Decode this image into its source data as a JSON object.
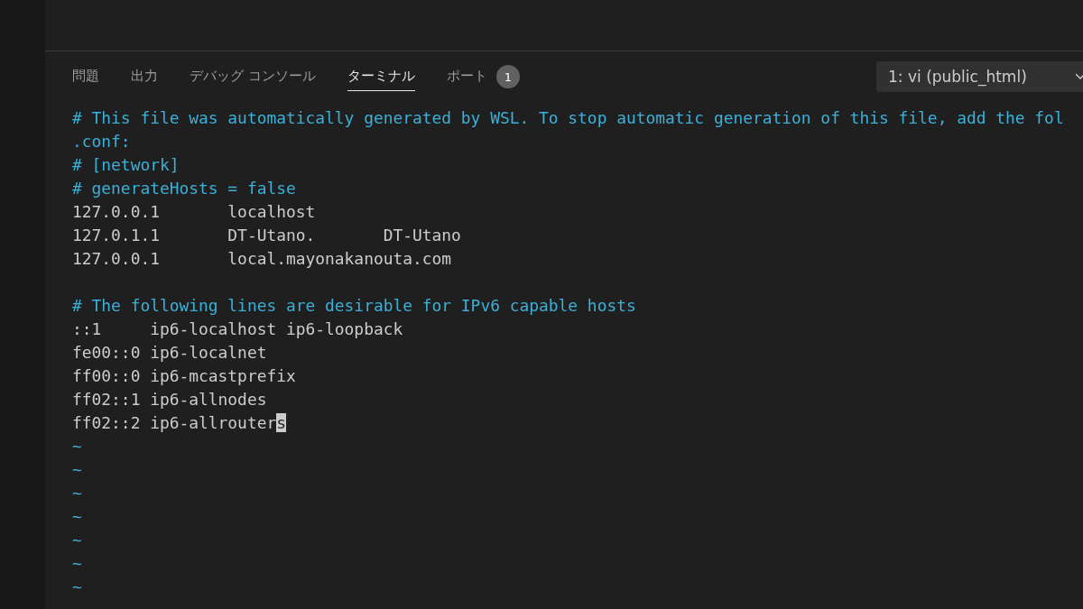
{
  "panel_tabs": [
    {
      "label": "問題",
      "selected": false
    },
    {
      "label": "出力",
      "selected": false
    },
    {
      "label": "デバッグ コンソール",
      "selected": false
    },
    {
      "label": "ターミナル",
      "selected": true
    },
    {
      "label": "ポート",
      "selected": false,
      "badge": "1"
    }
  ],
  "terminal_select": {
    "value": "1: vi (public_html)"
  },
  "terminal_lines": [
    {
      "kind": "comment",
      "text": "# This file was automatically generated by WSL. To stop automatic generation of this file, add the fol"
    },
    {
      "kind": "comment",
      "text": ".conf:"
    },
    {
      "kind": "comment",
      "text": "# [network]"
    },
    {
      "kind": "comment",
      "text": "# generateHosts = false"
    },
    {
      "kind": "plain",
      "text": "127.0.0.1       localhost"
    },
    {
      "kind": "plain",
      "text": "127.0.1.1       DT-Utano.       DT-Utano"
    },
    {
      "kind": "plain",
      "text": "127.0.0.1       local.mayonakanouta.com"
    },
    {
      "kind": "blank"
    },
    {
      "kind": "comment",
      "text": "# The following lines are desirable for IPv6 capable hosts"
    },
    {
      "kind": "plain",
      "text": "::1     ip6-localhost ip6-loopback"
    },
    {
      "kind": "plain",
      "text": "fe00::0 ip6-localnet"
    },
    {
      "kind": "plain",
      "text": "ff00::0 ip6-mcastprefix"
    },
    {
      "kind": "plain",
      "text": "ff02::1 ip6-allnodes"
    },
    {
      "kind": "plain",
      "text": "ff02::2 ip6-allrouter",
      "cursor_char": "s"
    },
    {
      "kind": "tilde",
      "text": "~"
    },
    {
      "kind": "tilde",
      "text": "~"
    },
    {
      "kind": "tilde",
      "text": "~"
    },
    {
      "kind": "tilde",
      "text": "~"
    },
    {
      "kind": "tilde",
      "text": "~"
    },
    {
      "kind": "tilde",
      "text": "~"
    },
    {
      "kind": "tilde",
      "text": "~"
    }
  ]
}
